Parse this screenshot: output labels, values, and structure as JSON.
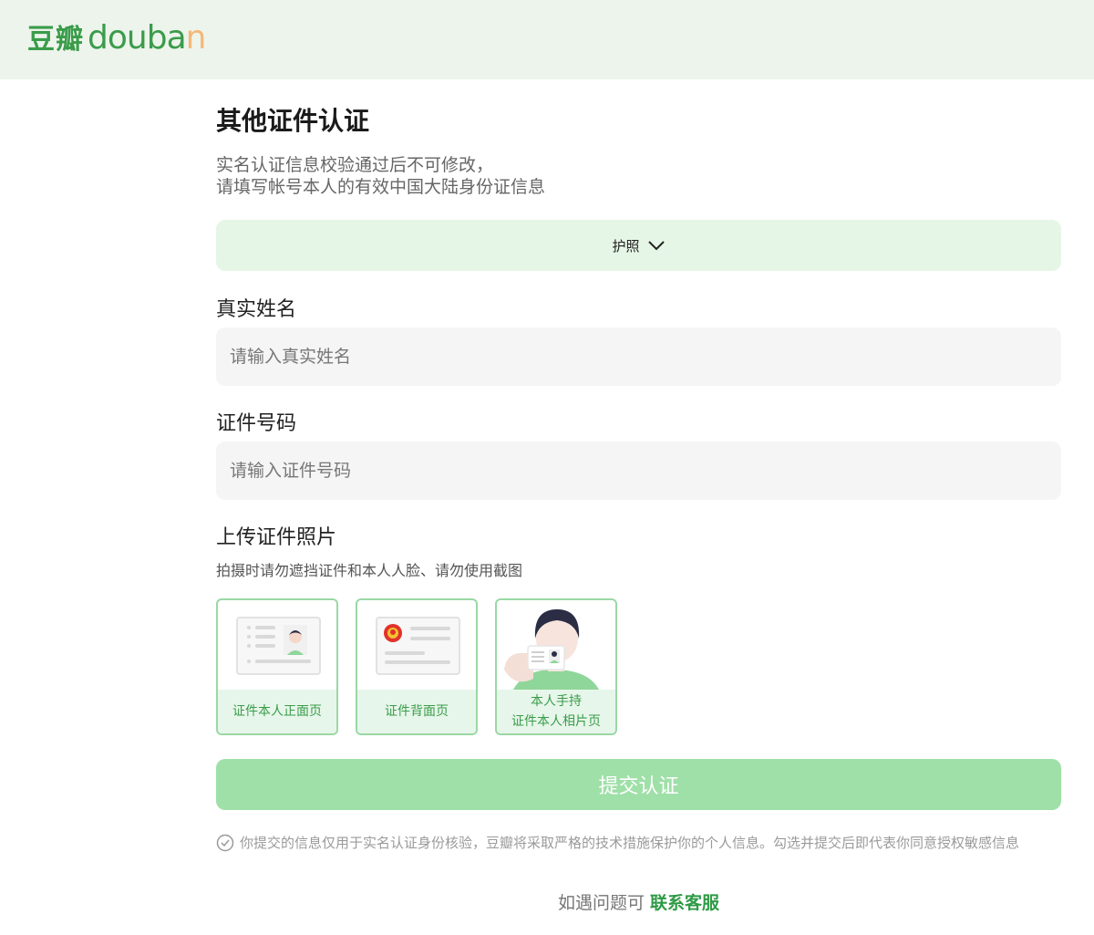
{
  "header": {
    "logo_cn": "豆瓣",
    "logo_en": [
      "d",
      "o",
      "u",
      "b",
      "a",
      "n"
    ]
  },
  "page": {
    "title": "其他证件认证",
    "desc_line1": "实名认证信息校验通过后不可修改，",
    "desc_line2": "请填写帐号本人的有效中国大陆身份证信息"
  },
  "doc_type": {
    "selected": "护照",
    "icon": "chevron-down-icon"
  },
  "form": {
    "name_label": "真实姓名",
    "name_placeholder": "请输入真实姓名",
    "id_label": "证件号码",
    "id_placeholder": "请输入证件号码",
    "upload_label": "上传证件照片",
    "upload_hint": "拍摄时请勿遮挡证件和本人人脸、请勿使用截图"
  },
  "uploads": [
    {
      "caption": "证件本人正面页"
    },
    {
      "caption": "证件背面页"
    },
    {
      "caption_line1": "本人手持",
      "caption_line2": "证件本人相片页"
    }
  ],
  "submit_label": "提交认证",
  "agreement": "你提交的信息仅用于实名认证身份核验，豆瓣将采取严格的技术措施保护你的个人信息。勾选并提交后即代表你同意授权敏感信息",
  "help": {
    "text": "如遇问题可",
    "link": "联系客服"
  },
  "colors": {
    "brand_green": "#3a9c4a",
    "topbar_bg": "#edf4ec",
    "select_bg": "#e5f6e6",
    "submit_bg": "#9fe0a8",
    "link_green": "#2e9a45"
  }
}
